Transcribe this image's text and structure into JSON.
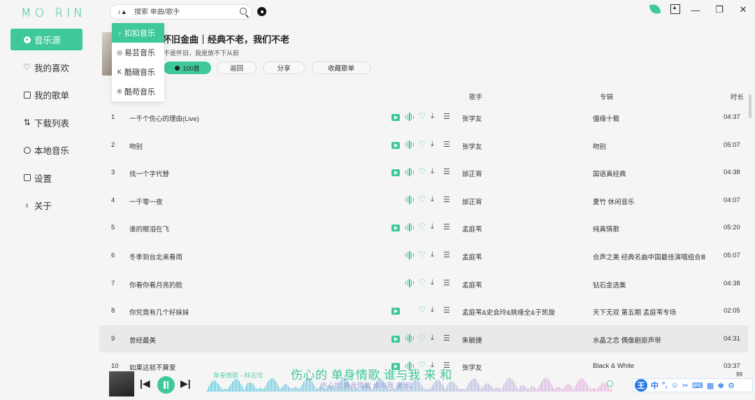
{
  "app": {
    "logo": "MO RIN"
  },
  "sidebar": {
    "items": [
      {
        "label": "音乐源",
        "icon": "music-source-icon",
        "active": true
      },
      {
        "label": "我的喜欢",
        "icon": "heart-icon"
      },
      {
        "label": "我的歌单",
        "icon": "playlist-icon"
      },
      {
        "label": "下载列表",
        "icon": "download-list-icon"
      },
      {
        "label": "本地音乐",
        "icon": "local-music-icon"
      },
      {
        "label": "设置",
        "icon": "settings-icon"
      },
      {
        "label": "关于",
        "icon": "bulb-icon"
      }
    ]
  },
  "search": {
    "placeholder": "搜索 单曲/歌手"
  },
  "sources": [
    {
      "label": "扣扣音乐",
      "glyph": "♪",
      "active": true
    },
    {
      "label": "易芸音乐",
      "glyph": "◎"
    },
    {
      "label": "酷硪音乐",
      "glyph": "K"
    },
    {
      "label": "酷苟音乐",
      "glyph": "®"
    }
  ],
  "playlist": {
    "title": "怀旧金曲｜经典不老，我们不老",
    "desc": "不是怀旧，我是放不下从前",
    "play_all": "100首",
    "back": "返回",
    "share": "分享",
    "collect": "收藏歌单"
  },
  "columns": {
    "artist": "歌手",
    "album": "专辑",
    "duration": "时长"
  },
  "songs": [
    {
      "idx": "1",
      "title": "一千个伤心的理由(Live)",
      "artist": "张学友",
      "album": "僵缘十载",
      "dur": "04:37",
      "mv": true,
      "wave": true
    },
    {
      "idx": "2",
      "title": "吻别",
      "artist": "张学友",
      "album": "吻别",
      "dur": "05:07",
      "mv": true,
      "wave": true
    },
    {
      "idx": "3",
      "title": "找一个字代替",
      "artist": "邰正宵",
      "album": "国语真经典",
      "dur": "04:38",
      "mv": true,
      "wave": true
    },
    {
      "idx": "4",
      "title": "一千零一夜",
      "artist": "邰正宵",
      "album": "夏竹 休闲音乐",
      "dur": "04:07",
      "mv": false,
      "wave": true
    },
    {
      "idx": "5",
      "title": "谁的眼泪在飞",
      "artist": "孟庭苇",
      "album": "纯真情歌",
      "dur": "05:20",
      "mv": true,
      "wave": true
    },
    {
      "idx": "6",
      "title": "冬季到台北来看雨",
      "artist": "孟庭苇",
      "album": "合声之美 经典名曲中国最佳演唱组合Ⅲ",
      "dur": "05:07",
      "mv": false,
      "wave": true
    },
    {
      "idx": "7",
      "title": "你看你看月亮的脸",
      "artist": "孟庭苇",
      "album": "钻石金选集",
      "dur": "04:38",
      "mv": false,
      "wave": true
    },
    {
      "idx": "8",
      "title": "你究竟有几个好妹妹",
      "artist": "孟庭苇&史会玲&姚缘全&于凯旋",
      "album": "天下无双 第五期 孟庭苇专场",
      "dur": "02:05",
      "mv": true,
      "wave": false
    },
    {
      "idx": "9",
      "title": "曾经最美",
      "artist": "朱毓捷",
      "album": "水晶之恋 偶像剧原声带",
      "dur": "04:31",
      "mv": true,
      "wave": true,
      "highlight": true
    },
    {
      "idx": "10",
      "title": "如果这就不算爱",
      "artist": "张学友",
      "album": "Black & White",
      "dur": "03:37",
      "mv": true,
      "wave": true
    }
  ],
  "player": {
    "now_playing": "单身情歌 - 林志炫",
    "lyric_main": "伤心的 单身情歌 谁与我 来 和",
    "lyric_sub": "伤心的 单身情歌 谁与我 来 和",
    "volume": "99"
  },
  "ime": {
    "lang": "中",
    "punct": "°,"
  },
  "colors": {
    "accent": "#3ec89b"
  }
}
